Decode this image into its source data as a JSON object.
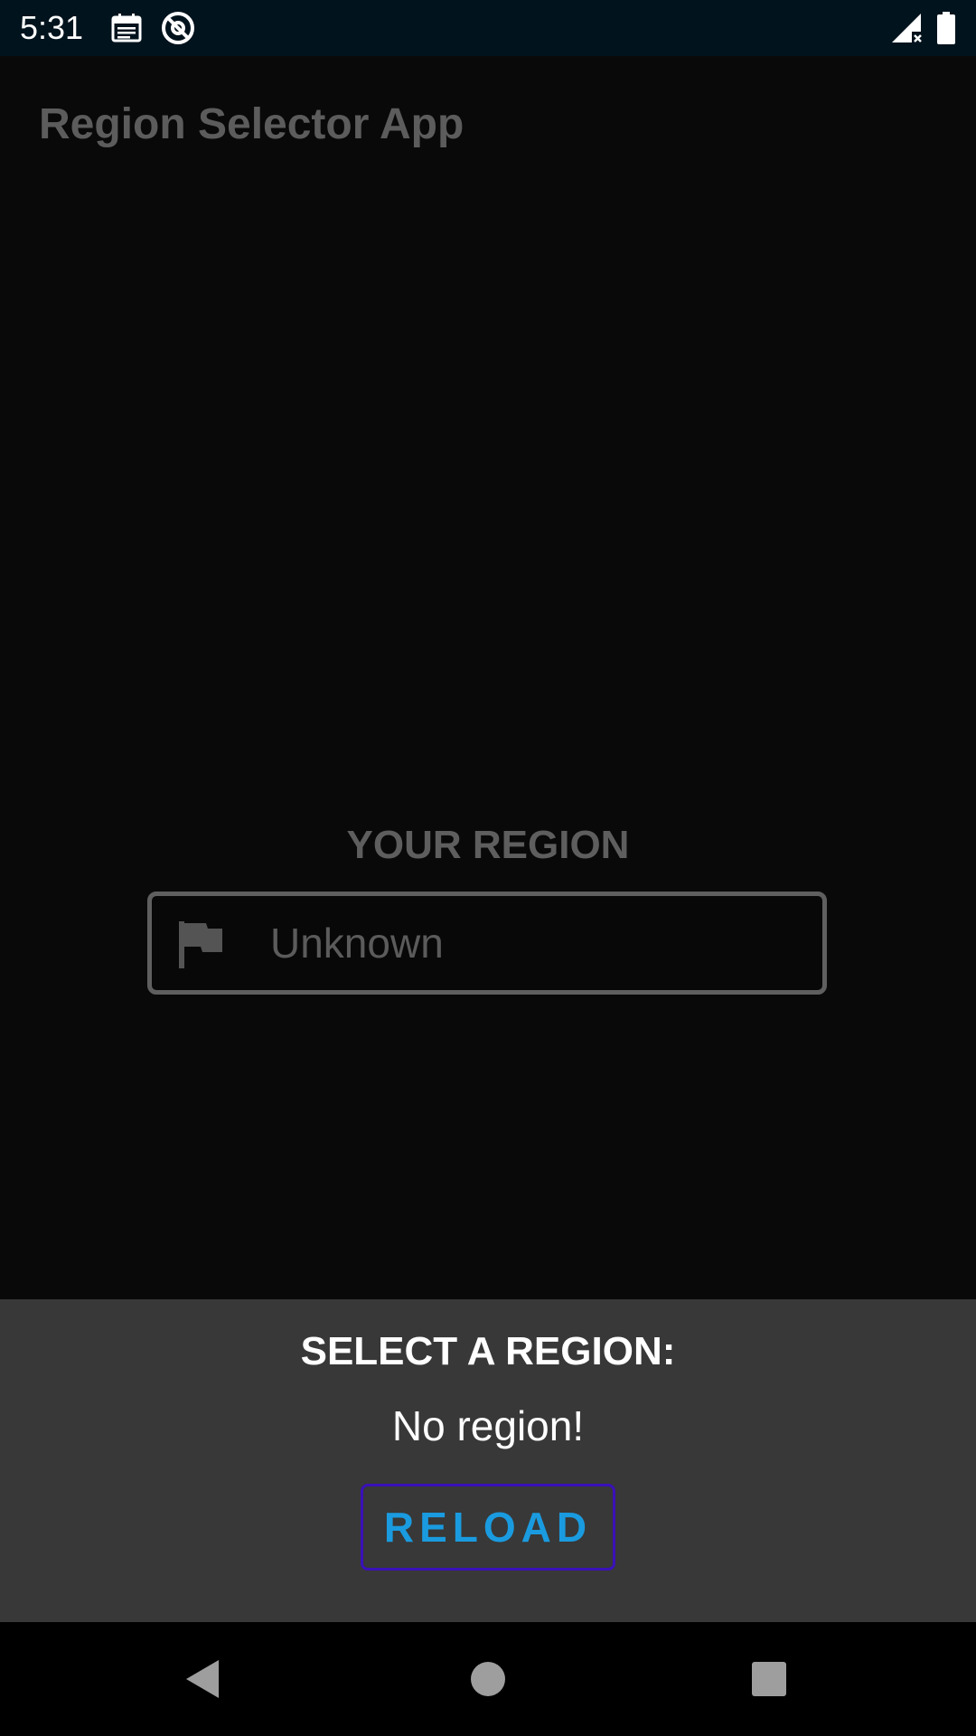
{
  "status_bar": {
    "time": "5:31",
    "left_icons": [
      "calendar-icon",
      "at-sign-circle-icon"
    ],
    "right_icons": [
      "signal-no-data-icon",
      "battery-icon"
    ]
  },
  "app": {
    "title": "Region Selector App"
  },
  "region": {
    "heading": "YOUR REGION",
    "icon": "flag-icon",
    "value": "Unknown"
  },
  "sheet": {
    "title": "SELECT A REGION:",
    "message": "No region!",
    "reload_label": "RELOAD"
  },
  "nav_bar": {
    "buttons": [
      "back-icon",
      "home-icon",
      "recents-icon"
    ]
  },
  "colors": {
    "status_bar_bg": "#01131d",
    "background": "#090909",
    "sheet_bg": "#383838",
    "reload_text": "#1a9be0",
    "reload_border": "#3a11b8",
    "muted_text": "#5c5c5c"
  }
}
